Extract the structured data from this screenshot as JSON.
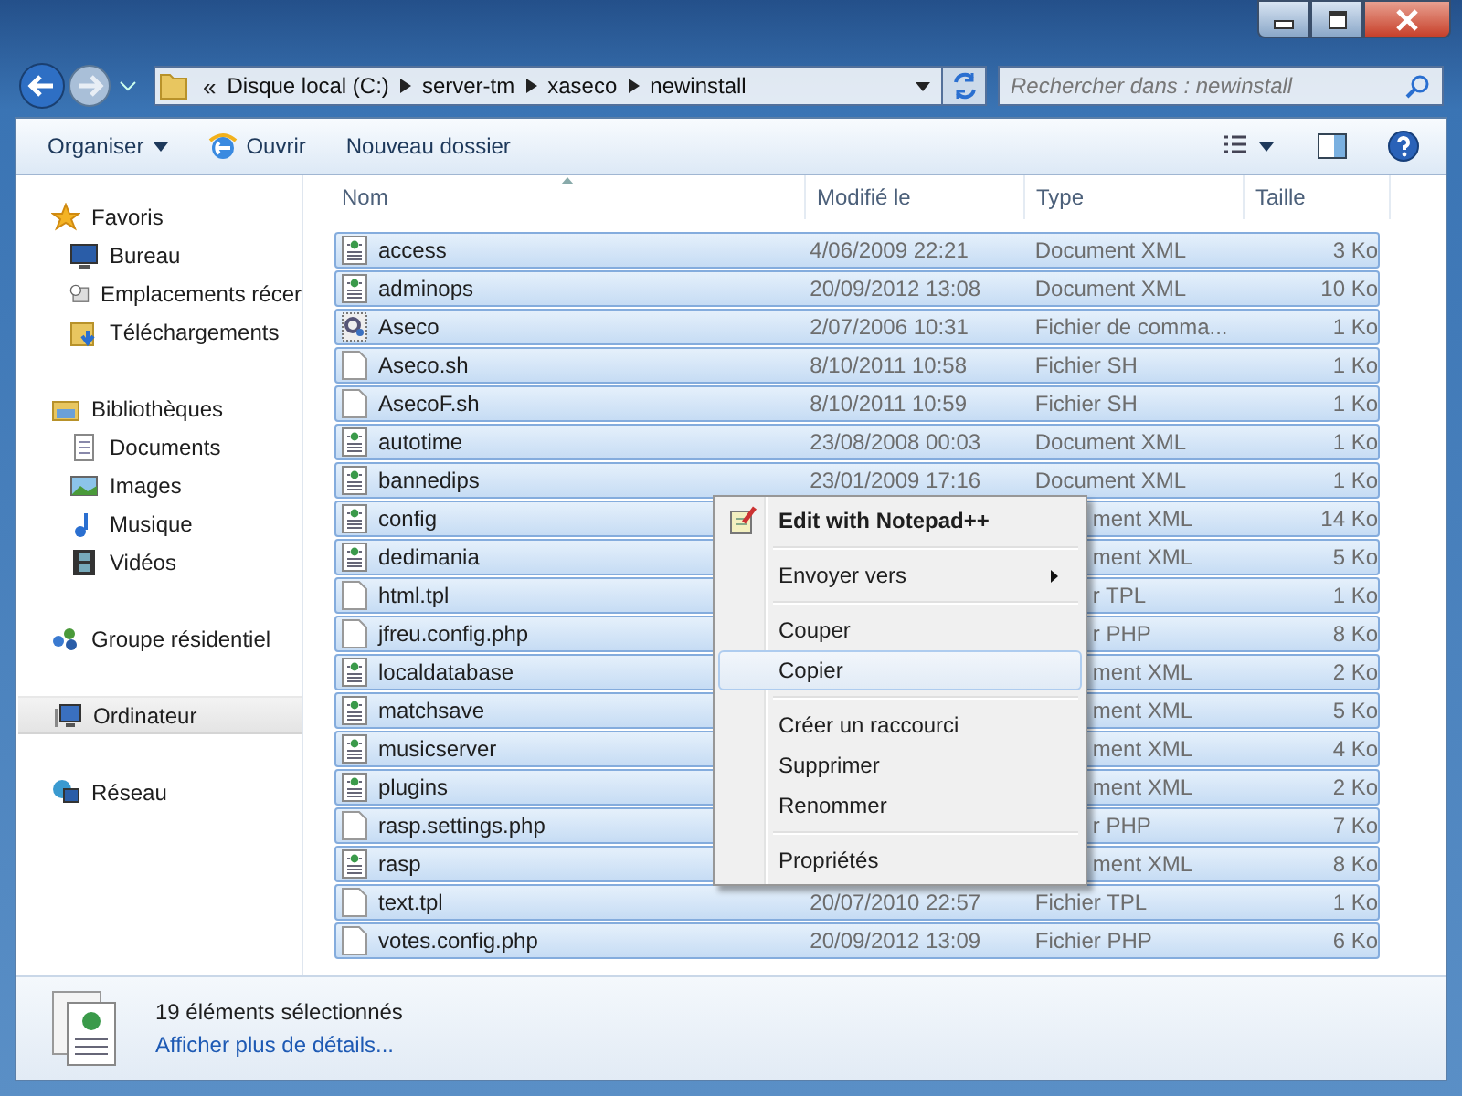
{
  "address": {
    "overflow": "«",
    "crumbs": [
      "Disque local (C:)",
      "server-tm",
      "xaseco",
      "newinstall"
    ]
  },
  "search": {
    "placeholder": "Rechercher dans : newinstall"
  },
  "toolbar": [
    {
      "label": "Organiser",
      "kind": "dropdown"
    },
    {
      "label": "Ouvrir",
      "kind": "open"
    },
    {
      "label": "Nouveau dossier",
      "kind": "plain"
    }
  ],
  "sidebar": [
    {
      "label": "Favoris",
      "selected": false,
      "children": [
        {
          "label": "Bureau",
          "selected": false
        },
        {
          "label": "Emplacements récer",
          "selected": false
        },
        {
          "label": "Téléchargements",
          "selected": false
        }
      ]
    },
    {
      "label": "Bibliothèques",
      "selected": false,
      "children": [
        {
          "label": "Documents",
          "selected": false
        },
        {
          "label": "Images",
          "selected": false
        },
        {
          "label": "Musique",
          "selected": false
        },
        {
          "label": "Vidéos",
          "selected": false
        }
      ]
    },
    {
      "label": "Groupe résidentiel",
      "selected": false
    },
    {
      "label": "Ordinateur",
      "selected": true
    },
    {
      "label": "Réseau",
      "selected": false
    }
  ],
  "table": {
    "columns": [
      "Nom",
      "Modifié le",
      "Type",
      "Taille"
    ],
    "rows": [
      {
        "name": "access",
        "kind": "xml",
        "modified": "4/06/2009 22:21",
        "type": "Document XML",
        "size": "3 Ko",
        "selected": true
      },
      {
        "name": "adminops",
        "kind": "xml",
        "modified": "20/09/2012 13:08",
        "type": "Document XML",
        "size": "10 Ko",
        "selected": true
      },
      {
        "name": "Aseco",
        "kind": "cmd",
        "modified": "2/07/2006 10:31",
        "type": "Fichier de comma...",
        "size": "1 Ko",
        "selected": true
      },
      {
        "name": "Aseco.sh",
        "kind": "plain",
        "modified": "8/10/2011 10:58",
        "type": "Fichier SH",
        "size": "1 Ko",
        "selected": true
      },
      {
        "name": "AsecoF.sh",
        "kind": "plain",
        "modified": "8/10/2011 10:59",
        "type": "Fichier SH",
        "size": "1 Ko",
        "selected": true
      },
      {
        "name": "autotime",
        "kind": "xml",
        "modified": "23/08/2008 00:03",
        "type": "Document XML",
        "size": "1 Ko",
        "selected": true
      },
      {
        "name": "bannedips",
        "kind": "xml",
        "modified": "23/01/2009 17:16",
        "type": "Document XML",
        "size": "1 Ko",
        "selected": true
      },
      {
        "name": "config",
        "kind": "xml",
        "type": "ment XML",
        "size": "14 Ko",
        "selected": true
      },
      {
        "name": "dedimania",
        "kind": "xml",
        "type": "ment XML",
        "size": "5 Ko",
        "selected": true
      },
      {
        "name": "html.tpl",
        "kind": "plain",
        "type": "r TPL",
        "size": "1 Ko",
        "selected": true
      },
      {
        "name": "jfreu.config.php",
        "kind": "plain",
        "type": "r PHP",
        "size": "8 Ko",
        "selected": true
      },
      {
        "name": "localdatabase",
        "kind": "xml",
        "type": "ment XML",
        "size": "2 Ko",
        "selected": true
      },
      {
        "name": "matchsave",
        "kind": "xml",
        "type": "ment XML",
        "size": "5 Ko",
        "selected": true
      },
      {
        "name": "musicserver",
        "kind": "xml",
        "type": "ment XML",
        "size": "4 Ko",
        "selected": true
      },
      {
        "name": "plugins",
        "kind": "xml",
        "type": "ment XML",
        "size": "2 Ko",
        "selected": true
      },
      {
        "name": "rasp.settings.php",
        "kind": "plain",
        "type": "r PHP",
        "size": "7 Ko",
        "selected": true
      },
      {
        "name": "rasp",
        "kind": "xml",
        "type": "ment XML",
        "size": "8 Ko",
        "selected": true
      },
      {
        "name": "text.tpl",
        "kind": "plain",
        "modified": "20/07/2010 22:57",
        "type": "Fichier TPL",
        "size": "1 Ko",
        "selected": true
      },
      {
        "name": "votes.config.php",
        "kind": "plain",
        "modified": "20/09/2012 13:09",
        "type": "Fichier PHP",
        "size": "6 Ko",
        "selected": true
      }
    ]
  },
  "context_menu": {
    "groups": [
      [
        {
          "label": "Edit with Notepad++",
          "kind": "app",
          "selected": false
        }
      ],
      [
        {
          "label": "Envoyer vers",
          "kind": "submenu",
          "selected": false
        }
      ],
      [
        {
          "label": "Couper",
          "kind": "plain",
          "selected": false
        },
        {
          "label": "Copier",
          "kind": "plain",
          "selected": true
        }
      ],
      [
        {
          "label": "Créer un raccourci",
          "kind": "plain",
          "selected": false
        },
        {
          "label": "Supprimer",
          "kind": "plain",
          "selected": false
        },
        {
          "label": "Renommer",
          "kind": "plain",
          "selected": false
        }
      ],
      [
        {
          "label": "Propriétés",
          "kind": "plain",
          "selected": false
        }
      ]
    ]
  },
  "status_bar": {
    "count": "19 éléments sélectionnés",
    "link": "Afficher plus de détails..."
  }
}
